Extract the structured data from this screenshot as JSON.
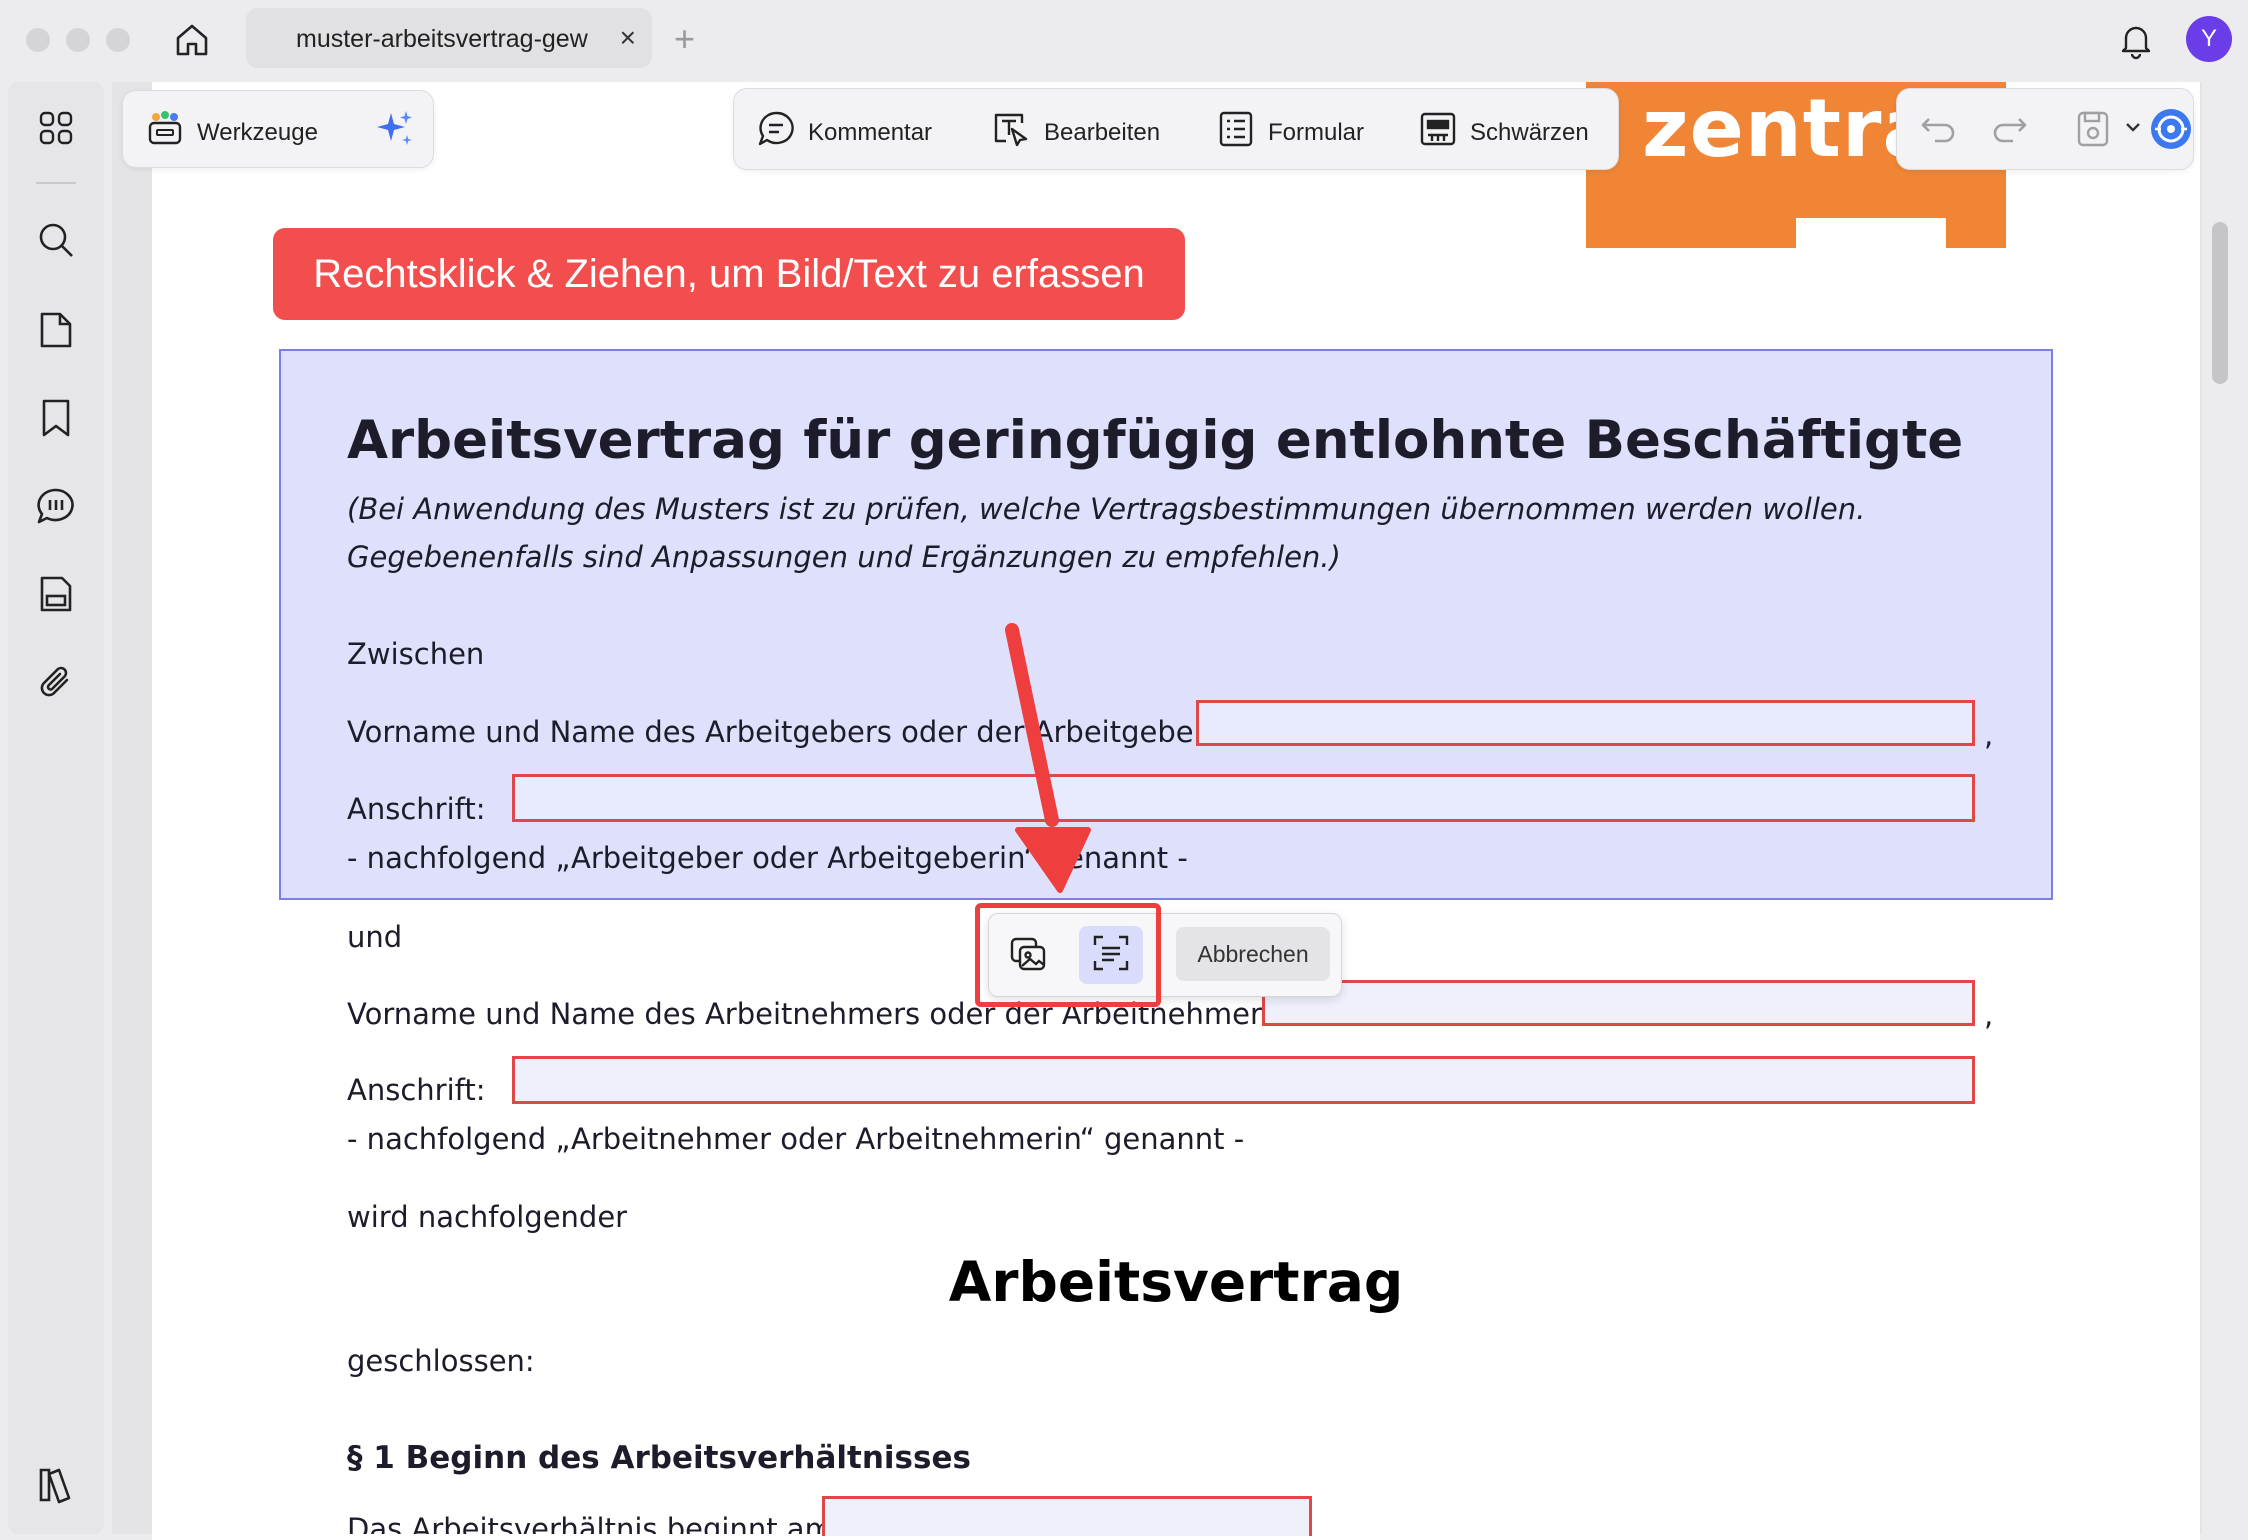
{
  "window": {
    "tab_title": "muster-arbeitsvertrag-gew",
    "tab_close": "×",
    "new_tab": "+",
    "avatar_letter": "Y"
  },
  "sidebar": {
    "items": [
      "apps-icon",
      "search-icon",
      "pages-icon",
      "bookmark-icon",
      "comments-icon",
      "document-icon",
      "attachment-icon"
    ],
    "bottom": "library-icon"
  },
  "toolbar_left": {
    "tools_label": "Werkzeuge"
  },
  "toolbar_center": {
    "items": [
      {
        "label": "Kommentar",
        "icon": "comment-icon"
      },
      {
        "label": "Bearbeiten",
        "icon": "edit-text-icon"
      },
      {
        "label": "Formular",
        "icon": "form-icon"
      },
      {
        "label": "Schwärzen",
        "icon": "redact-icon"
      }
    ]
  },
  "logo": {
    "text": "zentral"
  },
  "hint": {
    "text": "Rechtsklick & Ziehen, um Bild/Text zu erfassen"
  },
  "document": {
    "title": "Arbeitsvertrag für geringfügig entlohnte Beschäftigte",
    "note_line1": "(Bei Anwendung des Musters ist zu prüfen, welche Vertragsbestimmungen übernommen werden wollen.",
    "note_line2": "Gegebenenfalls sind Anpassungen und Ergänzungen zu empfehlen.)",
    "between": "Zwischen",
    "employer_name_label": "Vorname und Name des Arbeitgebers oder der Arbeitgeberin:",
    "address_label": "Anschrift:",
    "employer_suffix": "- nachfolgend „Arbeitgeber oder Arbeitgeberin“ genannt -",
    "and": "und",
    "employee_name_label": "Vorname und Name des Arbeitnehmers oder der Arbeitnehmerin:",
    "employee_suffix": "- nachfolgend „Arbeitnehmer oder Arbeitnehmerin“ genannt -",
    "following": "wird nachfolgender",
    "contract_heading": "Arbeitsvertrag",
    "concluded": "geschlossen:",
    "section1": "§ 1 Beginn des Arbeitsverhältnisses",
    "section1_text": "Das Arbeitsverhältnis beginnt am",
    "comma": ","
  },
  "popup": {
    "cancel_label": "Abbrechen"
  },
  "colors": {
    "hint_bg": "#f24e4e",
    "selection_bg": "#dfe0fb",
    "field_border": "#e04848",
    "logo_bg": "#ef8535",
    "avatar_bg": "#6a3de8"
  }
}
